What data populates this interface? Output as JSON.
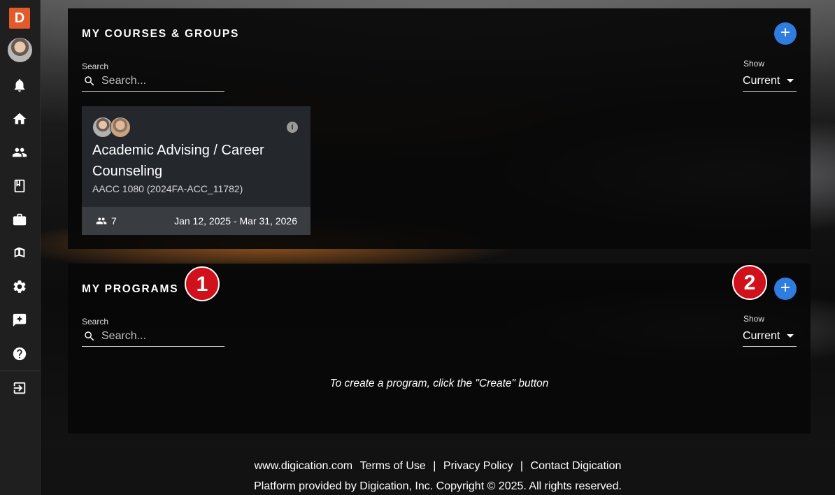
{
  "sidebar": {
    "logo_letter": "D",
    "icons": [
      "bell-icon",
      "home-icon",
      "people-icon",
      "book-icon",
      "briefcase-icon",
      "books-icon",
      "gear-icon",
      "feedback-icon",
      "help-icon",
      "logout-icon"
    ]
  },
  "courses": {
    "title": "MY COURSES & GROUPS",
    "add_label": "+",
    "search_label": "Search",
    "search_placeholder": "Search...",
    "show_label": "Show",
    "show_value": "Current",
    "card": {
      "title": "Academic Advising / Career Counseling",
      "code": "AACC 1080 (2024FA-ACC_11782)",
      "info": "i",
      "members": "7",
      "dates": "Jan 12, 2025 - Mar 31, 2026"
    }
  },
  "programs": {
    "title": "MY PROGRAMS",
    "add_label": "+",
    "search_label": "Search",
    "search_placeholder": "Search...",
    "show_label": "Show",
    "show_value": "Current",
    "empty_message": "To create a program, click the \"Create\" button"
  },
  "markers": {
    "one": "1",
    "two": "2"
  },
  "footer": {
    "link_site": "www.digication.com",
    "link_terms": "Terms of Use",
    "sep1": "|",
    "link_privacy": "Privacy Policy",
    "sep2": "|",
    "link_contact": "Contact Digication",
    "copyright": "Platform provided by Digication, Inc. Copyright © 2025. All rights reserved."
  },
  "colors": {
    "accent_blue": "#2f7de1",
    "logo_orange": "#e35a2b",
    "marker_red": "#d0101a"
  }
}
